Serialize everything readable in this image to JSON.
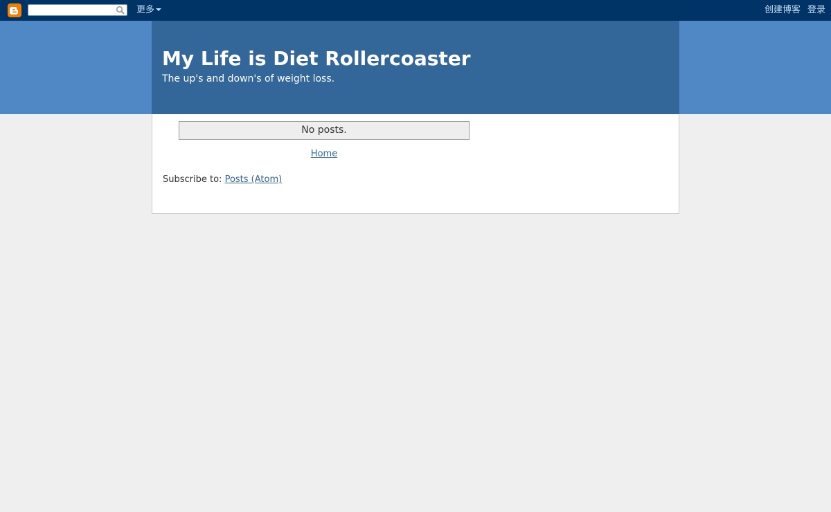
{
  "navbar": {
    "logo_icon": "blogger-logo-icon",
    "search_placeholder": "",
    "search_value": "",
    "more_label": "更多",
    "create_blog_label": "创建博客",
    "login_label": "登录"
  },
  "header": {
    "title": "My Life is Diet Rollercoaster",
    "description": "The up's and down's of weight loss."
  },
  "main": {
    "no_posts_text": "No posts.",
    "home_link": "Home",
    "subscribe_prefix": "Subscribe to: ",
    "subscribe_link": "Posts (Atom)"
  },
  "colors": {
    "navbar_bg": "#003366",
    "header_band": "#5088c6",
    "header_box": "#336699",
    "page_bg": "#efefef",
    "link": "#336699",
    "logo": "#f57d00"
  }
}
